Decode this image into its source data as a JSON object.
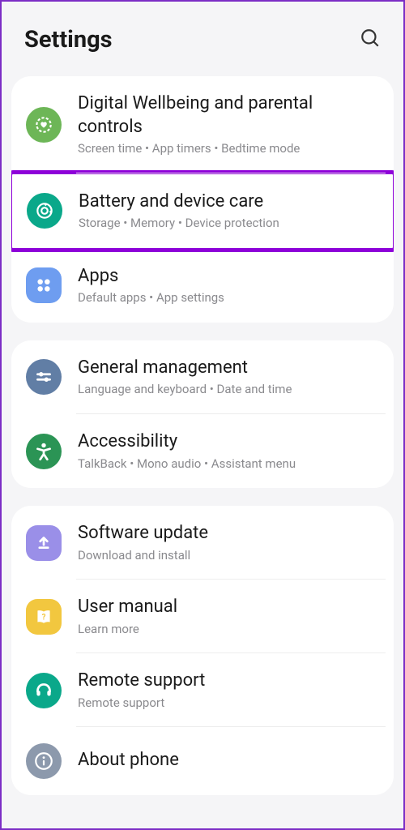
{
  "header": {
    "title": "Settings"
  },
  "groups": [
    {
      "items": [
        {
          "title": "Digital Wellbeing and parental controls",
          "subtitle": "Screen time  •  App timers  •  Bedtime mode"
        },
        {
          "title": "Battery and device care",
          "subtitle": "Storage  •  Memory  •  Device protection"
        },
        {
          "title": "Apps",
          "subtitle": "Default apps  •  App settings"
        }
      ]
    },
    {
      "items": [
        {
          "title": "General management",
          "subtitle": "Language and keyboard  •  Date and time"
        },
        {
          "title": "Accessibility",
          "subtitle": "TalkBack  •  Mono audio  •  Assistant menu"
        }
      ]
    },
    {
      "items": [
        {
          "title": "Software update",
          "subtitle": "Download and install"
        },
        {
          "title": "User manual",
          "subtitle": "Learn more"
        },
        {
          "title": "Remote support",
          "subtitle": "Remote support"
        },
        {
          "title": "About phone",
          "subtitle": ""
        }
      ]
    }
  ]
}
